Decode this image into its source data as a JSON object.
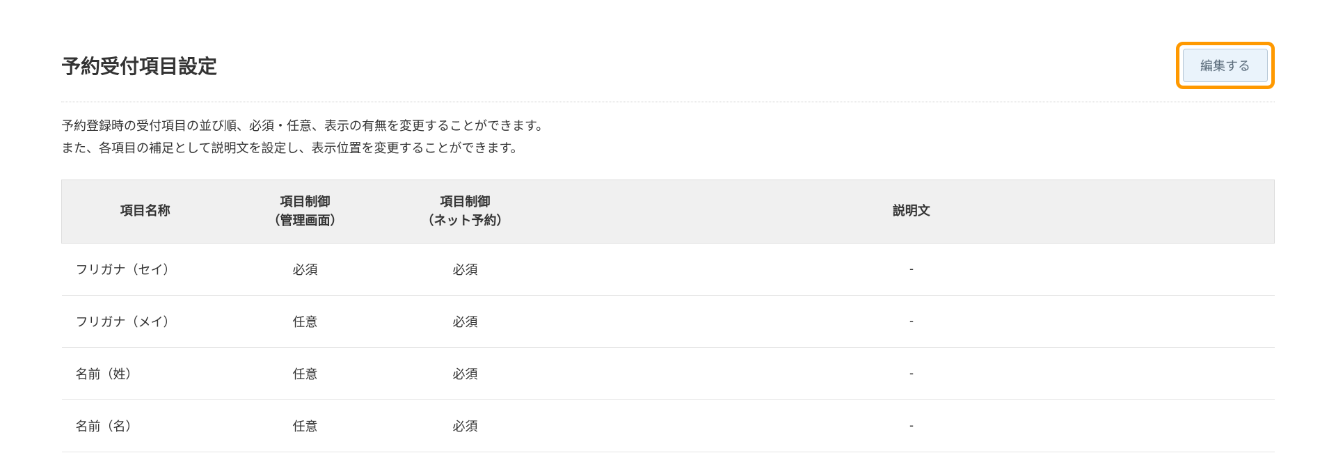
{
  "header": {
    "title": "予約受付項目設定",
    "edit_button_label": "編集する"
  },
  "description": {
    "line1": "予約登録時の受付項目の並び順、必須・任意、表示の有無を変更することができます。",
    "line2": "また、各項目の補足として説明文を設定し、表示位置を変更することができます。"
  },
  "table": {
    "headers": {
      "name": "項目名称",
      "admin_line1": "項目制御",
      "admin_line2": "（管理画面）",
      "net_line1": "項目制御",
      "net_line2": "（ネット予約）",
      "description": "説明文"
    },
    "rows": [
      {
        "name": "フリガナ（セイ）",
        "admin": "必須",
        "net": "必須",
        "desc": "-"
      },
      {
        "name": "フリガナ（メイ）",
        "admin": "任意",
        "net": "必須",
        "desc": "-"
      },
      {
        "name": "名前（姓）",
        "admin": "任意",
        "net": "必須",
        "desc": "-"
      },
      {
        "name": "名前（名）",
        "admin": "任意",
        "net": "必須",
        "desc": "-"
      }
    ]
  }
}
